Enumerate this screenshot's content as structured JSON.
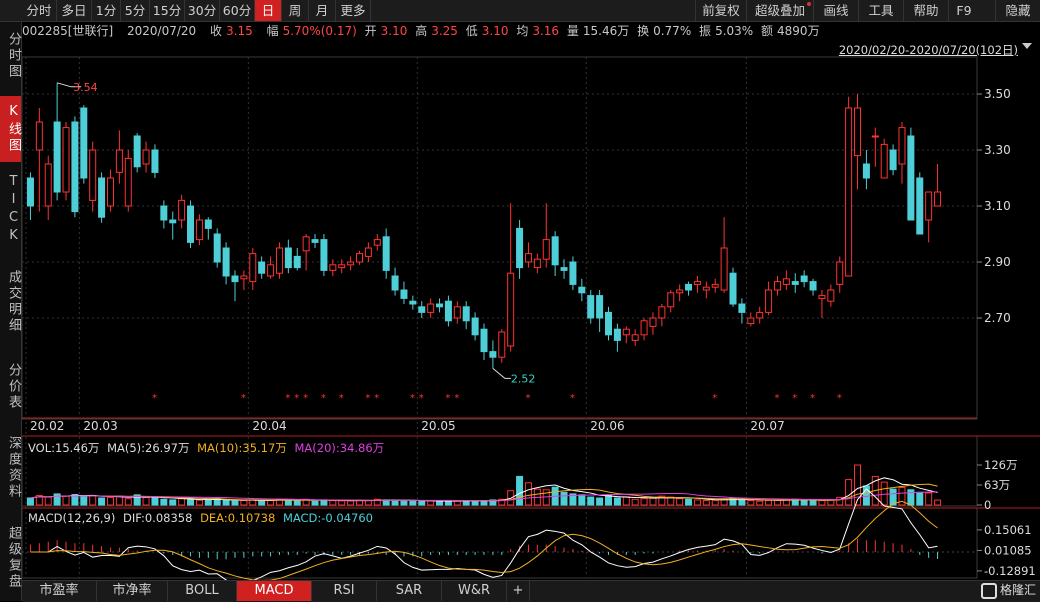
{
  "toolbar": {
    "periods": [
      "分时",
      "多日",
      "1分",
      "5分",
      "15分",
      "30分",
      "60分",
      "日",
      "周",
      "月",
      "更多"
    ],
    "active_period": "日",
    "right_items": [
      "前复权",
      "超级叠加",
      "画线",
      "工具",
      "帮助",
      "F9",
      "隐藏"
    ]
  },
  "sidebar": [
    "分时图",
    "K线图",
    "TICK",
    "成交明细",
    "分价表",
    "深度资料",
    "超级复盘"
  ],
  "info": {
    "code": "002285[世联行]",
    "date": "2020/07/20",
    "close_label": "收",
    "close": "3.15",
    "range_label": "幅",
    "range": "5.70%(0.17)",
    "open_label": "开",
    "open": "3.10",
    "high_label": "高",
    "high": "3.25",
    "low_label": "低",
    "low": "3.10",
    "avg_label": "均",
    "avg": "3.16",
    "volume_label": "量",
    "volume": "15.46万",
    "turnover_label": "换",
    "turnover": "0.77%",
    "amplitude_label": "振",
    "amplitude": "5.03%",
    "amount_label": "额",
    "amount": "4890万"
  },
  "date_range": "2020/02/20-2020/07/20(102日)",
  "kline": {
    "max_label": "3.54",
    "min_label": "2.52",
    "yticks": [
      "3.50",
      "3.30",
      "3.10",
      "2.90",
      "2.70"
    ],
    "xticks": [
      "20.02",
      "20.03",
      "20.04",
      "20.05",
      "20.06",
      "20.07"
    ]
  },
  "volume_panel": {
    "vol": "VOL:15.46万",
    "ma5": "MA(5):26.97万",
    "ma10": "MA(10):35.17万",
    "ma20": "MA(20):34.86万",
    "yticks": [
      "126万",
      "63万",
      "0"
    ]
  },
  "macd_panel": {
    "name": "MACD(12,26,9)",
    "dif": "DIF:0.08358",
    "dea": "DEA:0.10738",
    "macd": "MACD:-0.04760",
    "yticks": [
      "0.15061",
      "0.01085",
      "-0.12891"
    ]
  },
  "bottom_tabs": [
    "市盈率",
    "市净率",
    "BOLL",
    "MACD",
    "RSI",
    "SAR",
    "W&R",
    "+"
  ],
  "active_bottom": "MACD",
  "logo": "格隆汇",
  "colors": {
    "up": "#ff3232",
    "down": "#4ecfd8",
    "ma5": "#ffffff",
    "ma10": "#f0b020",
    "ma20": "#e040e0"
  },
  "chart_data": {
    "type": "candlestick",
    "open": [
      3.2,
      3.3,
      3.1,
      3.4,
      3.15,
      3.4,
      3.45,
      3.12,
      3.2,
      3.1,
      3.22,
      3.1,
      3.35,
      3.25,
      3.3,
      3.1,
      3.05,
      3.05,
      3.1,
      2.98,
      3.05,
      3.0,
      2.95,
      2.85,
      2.84,
      2.83,
      2.9,
      2.85,
      2.86,
      2.95,
      2.92,
      2.94,
      2.98,
      2.98,
      2.87,
      2.88,
      2.89,
      2.9,
      2.92,
      2.96,
      2.99,
      2.85,
      2.8,
      2.76,
      2.74,
      2.72,
      2.75,
      2.76,
      2.7,
      2.74,
      2.7,
      2.66,
      2.58,
      2.56,
      2.6,
      3.02,
      2.9,
      2.88,
      2.91,
      2.99,
      2.88,
      2.9,
      2.81,
      2.78,
      2.78,
      2.72,
      2.66,
      2.64,
      2.62,
      2.64,
      2.67,
      2.7,
      2.74,
      2.79,
      2.82,
      2.82,
      2.8,
      2.81,
      2.8,
      2.86,
      2.75,
      2.68,
      2.7,
      2.72,
      2.8,
      2.82,
      2.83,
      2.85,
      2.83,
      2.77,
      2.76,
      2.82,
      2.85,
      3.28,
      3.25,
      3.35,
      3.2,
      3.3,
      3.25,
      3.35,
      3.2,
      3.05,
      3.1
    ],
    "close": [
      3.1,
      3.4,
      3.25,
      3.15,
      3.38,
      3.08,
      3.2,
      3.3,
      3.06,
      3.2,
      3.3,
      3.27,
      3.24,
      3.3,
      3.22,
      3.05,
      3.04,
      3.12,
      2.97,
      3.05,
      3.02,
      2.9,
      2.85,
      2.83,
      2.85,
      2.93,
      2.86,
      2.89,
      2.95,
      2.88,
      2.88,
      2.99,
      2.97,
      2.87,
      2.89,
      2.89,
      2.9,
      2.93,
      2.95,
      2.98,
      2.87,
      2.8,
      2.77,
      2.75,
      2.72,
      2.75,
      2.74,
      2.69,
      2.74,
      2.69,
      2.64,
      2.58,
      2.56,
      2.65,
      2.86,
      2.88,
      2.93,
      2.91,
      2.98,
      2.89,
      2.87,
      2.82,
      2.79,
      2.7,
      2.7,
      2.64,
      2.62,
      2.66,
      2.64,
      2.69,
      2.7,
      2.74,
      2.79,
      2.8,
      2.8,
      2.83,
      2.81,
      2.82,
      2.95,
      2.75,
      2.72,
      2.7,
      2.72,
      2.8,
      2.83,
      2.84,
      2.82,
      2.83,
      2.8,
      2.78,
      2.8,
      2.9,
      3.45,
      3.45,
      3.2,
      3.35,
      3.32,
      3.23,
      3.38,
      3.05,
      3.0,
      3.15,
      3.15
    ],
    "high": [
      3.22,
      3.45,
      3.28,
      3.54,
      3.4,
      3.42,
      3.46,
      3.33,
      3.22,
      3.23,
      3.37,
      3.3,
      3.36,
      3.33,
      3.32,
      3.12,
      3.08,
      3.14,
      3.12,
      3.07,
      3.06,
      3.02,
      2.97,
      2.87,
      2.87,
      2.95,
      2.92,
      2.92,
      2.97,
      2.98,
      2.95,
      3.0,
      3.0,
      3.0,
      2.91,
      2.91,
      2.92,
      2.94,
      2.97,
      3.0,
      3.02,
      2.88,
      2.83,
      2.78,
      2.76,
      2.77,
      2.77,
      2.78,
      2.76,
      2.76,
      2.72,
      2.68,
      2.62,
      2.66,
      3.11,
      3.05,
      2.97,
      2.93,
      3.11,
      3.01,
      2.91,
      2.92,
      2.84,
      2.8,
      2.8,
      2.74,
      2.68,
      2.67,
      2.66,
      2.7,
      2.72,
      2.75,
      2.8,
      2.82,
      2.83,
      2.85,
      2.83,
      2.84,
      3.06,
      2.88,
      2.77,
      2.72,
      2.74,
      2.83,
      2.85,
      2.87,
      2.86,
      2.87,
      2.84,
      2.8,
      2.82,
      2.92,
      3.49,
      3.5,
      3.3,
      3.38,
      3.34,
      3.32,
      3.4,
      3.38,
      3.22,
      3.08,
      3.25
    ],
    "low": [
      3.05,
      3.08,
      3.05,
      3.12,
      3.12,
      3.06,
      3.18,
      3.08,
      3.04,
      3.08,
      3.18,
      3.08,
      3.22,
      3.22,
      3.2,
      3.02,
      2.98,
      3.02,
      2.95,
      2.96,
      2.98,
      2.88,
      2.82,
      2.76,
      2.8,
      2.8,
      2.84,
      2.84,
      2.84,
      2.86,
      2.87,
      2.87,
      2.95,
      2.85,
      2.85,
      2.86,
      2.87,
      2.89,
      2.9,
      2.94,
      2.84,
      2.78,
      2.75,
      2.73,
      2.7,
      2.7,
      2.72,
      2.67,
      2.68,
      2.66,
      2.62,
      2.55,
      2.52,
      2.54,
      2.58,
      2.84,
      2.88,
      2.86,
      2.88,
      2.85,
      2.84,
      2.8,
      2.76,
      2.68,
      2.65,
      2.62,
      2.58,
      2.61,
      2.6,
      2.62,
      2.64,
      2.67,
      2.72,
      2.76,
      2.78,
      2.79,
      2.77,
      2.79,
      2.79,
      2.74,
      2.68,
      2.67,
      2.68,
      2.71,
      2.78,
      2.8,
      2.79,
      2.81,
      2.78,
      2.7,
      2.74,
      2.79,
      3.0,
      3.16,
      3.16,
      3.24,
      3.22,
      3.21,
      3.18,
      3.05,
      3.0,
      2.97,
      3.1
    ],
    "volume": [
      22,
      30,
      25,
      35,
      28,
      33,
      26,
      30,
      22,
      24,
      28,
      20,
      32,
      24,
      22,
      18,
      16,
      20,
      18,
      15,
      16,
      20,
      14,
      12,
      14,
      16,
      14,
      14,
      18,
      16,
      14,
      18,
      12,
      16,
      14,
      13,
      13,
      15,
      14,
      18,
      16,
      15,
      14,
      12,
      12,
      13,
      12,
      14,
      12,
      14,
      12,
      14,
      16,
      18,
      45,
      90,
      70,
      50,
      48,
      56,
      40,
      35,
      32,
      25,
      22,
      30,
      22,
      26,
      18,
      20,
      22,
      28,
      25,
      20,
      18,
      16,
      14,
      15,
      18,
      22,
      16,
      14,
      12,
      14,
      16,
      18,
      18,
      14,
      15,
      14,
      16,
      24,
      80,
      126,
      60,
      90,
      72,
      50,
      55,
      48,
      40,
      38,
      15.46
    ],
    "macd": [
      0.05,
      0.06,
      0.07,
      0.08,
      0.07,
      0.06,
      0.06,
      0.05,
      0.04,
      0.03,
      0.03,
      0.02,
      0.01,
      0.01,
      0.0,
      -0.01,
      -0.02,
      -0.03,
      -0.03,
      -0.04,
      -0.04,
      -0.05,
      -0.05,
      -0.04,
      -0.04,
      -0.03,
      -0.03,
      -0.03,
      -0.02,
      -0.02,
      -0.02,
      -0.01,
      -0.02,
      -0.02,
      -0.02,
      -0.02,
      -0.02,
      -0.02,
      -0.01,
      -0.01,
      -0.02,
      -0.02,
      -0.03,
      -0.03,
      -0.03,
      -0.02,
      -0.02,
      -0.02,
      -0.02,
      -0.02,
      -0.02,
      -0.02,
      -0.02,
      -0.02,
      0.02,
      0.04,
      0.05,
      0.05,
      0.05,
      0.04,
      0.03,
      0.02,
      0.01,
      0.0,
      -0.01,
      -0.02,
      -0.02,
      -0.02,
      -0.02,
      -0.01,
      -0.01,
      0.0,
      0.0,
      0.01,
      0.01,
      0.01,
      0.01,
      0.01,
      0.02,
      0.01,
      0.0,
      -0.01,
      -0.01,
      0.0,
      0.0,
      0.0,
      0.0,
      0.0,
      0.0,
      -0.01,
      0.0,
      0.01,
      0.06,
      0.09,
      0.08,
      0.08,
      0.07,
      0.06,
      0.05,
      0.02,
      -0.02,
      -0.04,
      -0.0476
    ]
  }
}
